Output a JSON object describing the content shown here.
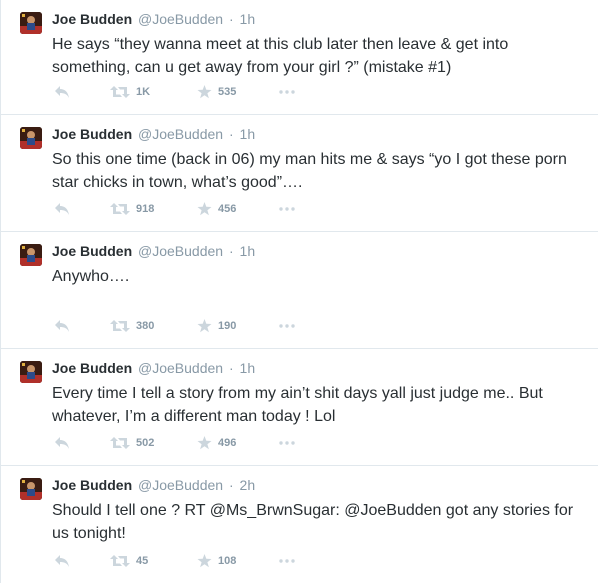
{
  "tweets": [
    {
      "name": "Joe Budden",
      "handle": "@JoeBudden",
      "separator": "·",
      "time": "1h",
      "text": "He says “they wanna meet at this club later then leave & get into something, can u get away from your girl ?” (mistake #1)",
      "retweets": "1K",
      "favorites": "535"
    },
    {
      "name": "Joe Budden",
      "handle": "@JoeBudden",
      "separator": "·",
      "time": "1h",
      "text": "So this one time (back in 06) my man hits me & says “yo I got these porn star chicks in town, what’s good”….",
      "retweets": "918",
      "favorites": "456"
    },
    {
      "name": "Joe Budden",
      "handle": "@JoeBudden",
      "separator": "·",
      "time": "1h",
      "text": "Anywho….",
      "retweets": "380",
      "favorites": "190"
    },
    {
      "name": "Joe Budden",
      "handle": "@JoeBudden",
      "separator": "·",
      "time": "1h",
      "text": "Every time I tell a story from my ain’t shit days yall just judge me.. But whatever, I’m a different man today ! Lol",
      "retweets": "502",
      "favorites": "496"
    },
    {
      "name": "Joe Budden",
      "handle": "@JoeBudden",
      "separator": "·",
      "time": "2h",
      "text": "Should I tell one ? RT @Ms_BrwnSugar: @JoeBudden got any stories for us tonight!",
      "retweets": "45",
      "favorites": "108"
    }
  ],
  "icons": {
    "reply": "reply-icon",
    "retweet": "retweet-icon",
    "favorite": "star-icon",
    "more": "more-icon"
  },
  "colors": {
    "icon_gray": "#ccd6dd",
    "meta_gray": "#8899a6",
    "text": "#292f33",
    "divider": "#e1e8ed"
  }
}
